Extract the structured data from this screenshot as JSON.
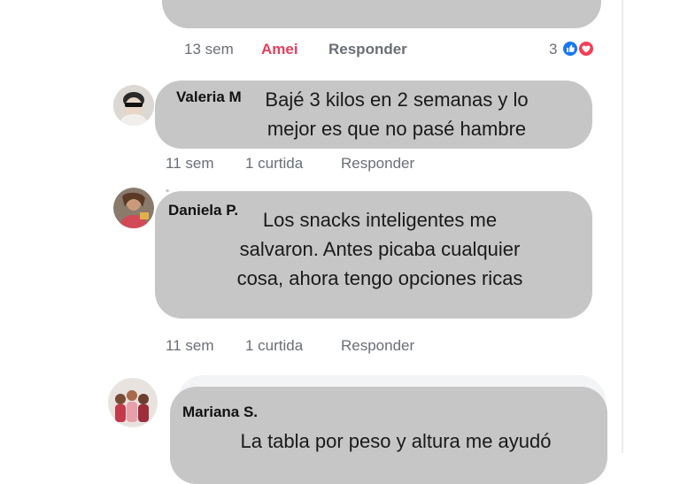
{
  "comments": [
    {
      "text_lines": [],
      "actions": {
        "time": "13 sem",
        "like": "Amei",
        "reply": "Responder"
      },
      "reactions": {
        "count": "3",
        "icons": [
          "like-icon",
          "love-icon"
        ]
      }
    },
    {
      "author": "Valeria M",
      "text_lines": [
        "Bajé 3 kilos en 2 semanas y lo",
        "mejor es que no pasé hambre"
      ],
      "actions": {
        "time": "11 sem",
        "like": "1 curtida",
        "reply": "Responder"
      }
    },
    {
      "author": "Daniela P.",
      "text_lines": [
        "Los snacks inteligentes me",
        "salvaron. Antes picaba cualquier",
        "cosa, ahora tengo opciones ricas"
      ],
      "actions": {
        "time": "11 sem",
        "like": "1 curtida",
        "reply": "Responder"
      }
    },
    {
      "author": "Mariana S.",
      "text_lines": [
        "La tabla por peso y altura me ayudó"
      ]
    }
  ],
  "colors": {
    "bubble": "#c6c6c6",
    "amei": "#e0405e",
    "meta": "#6a6f76",
    "like": "#1877f2",
    "love": "#f33e58"
  }
}
